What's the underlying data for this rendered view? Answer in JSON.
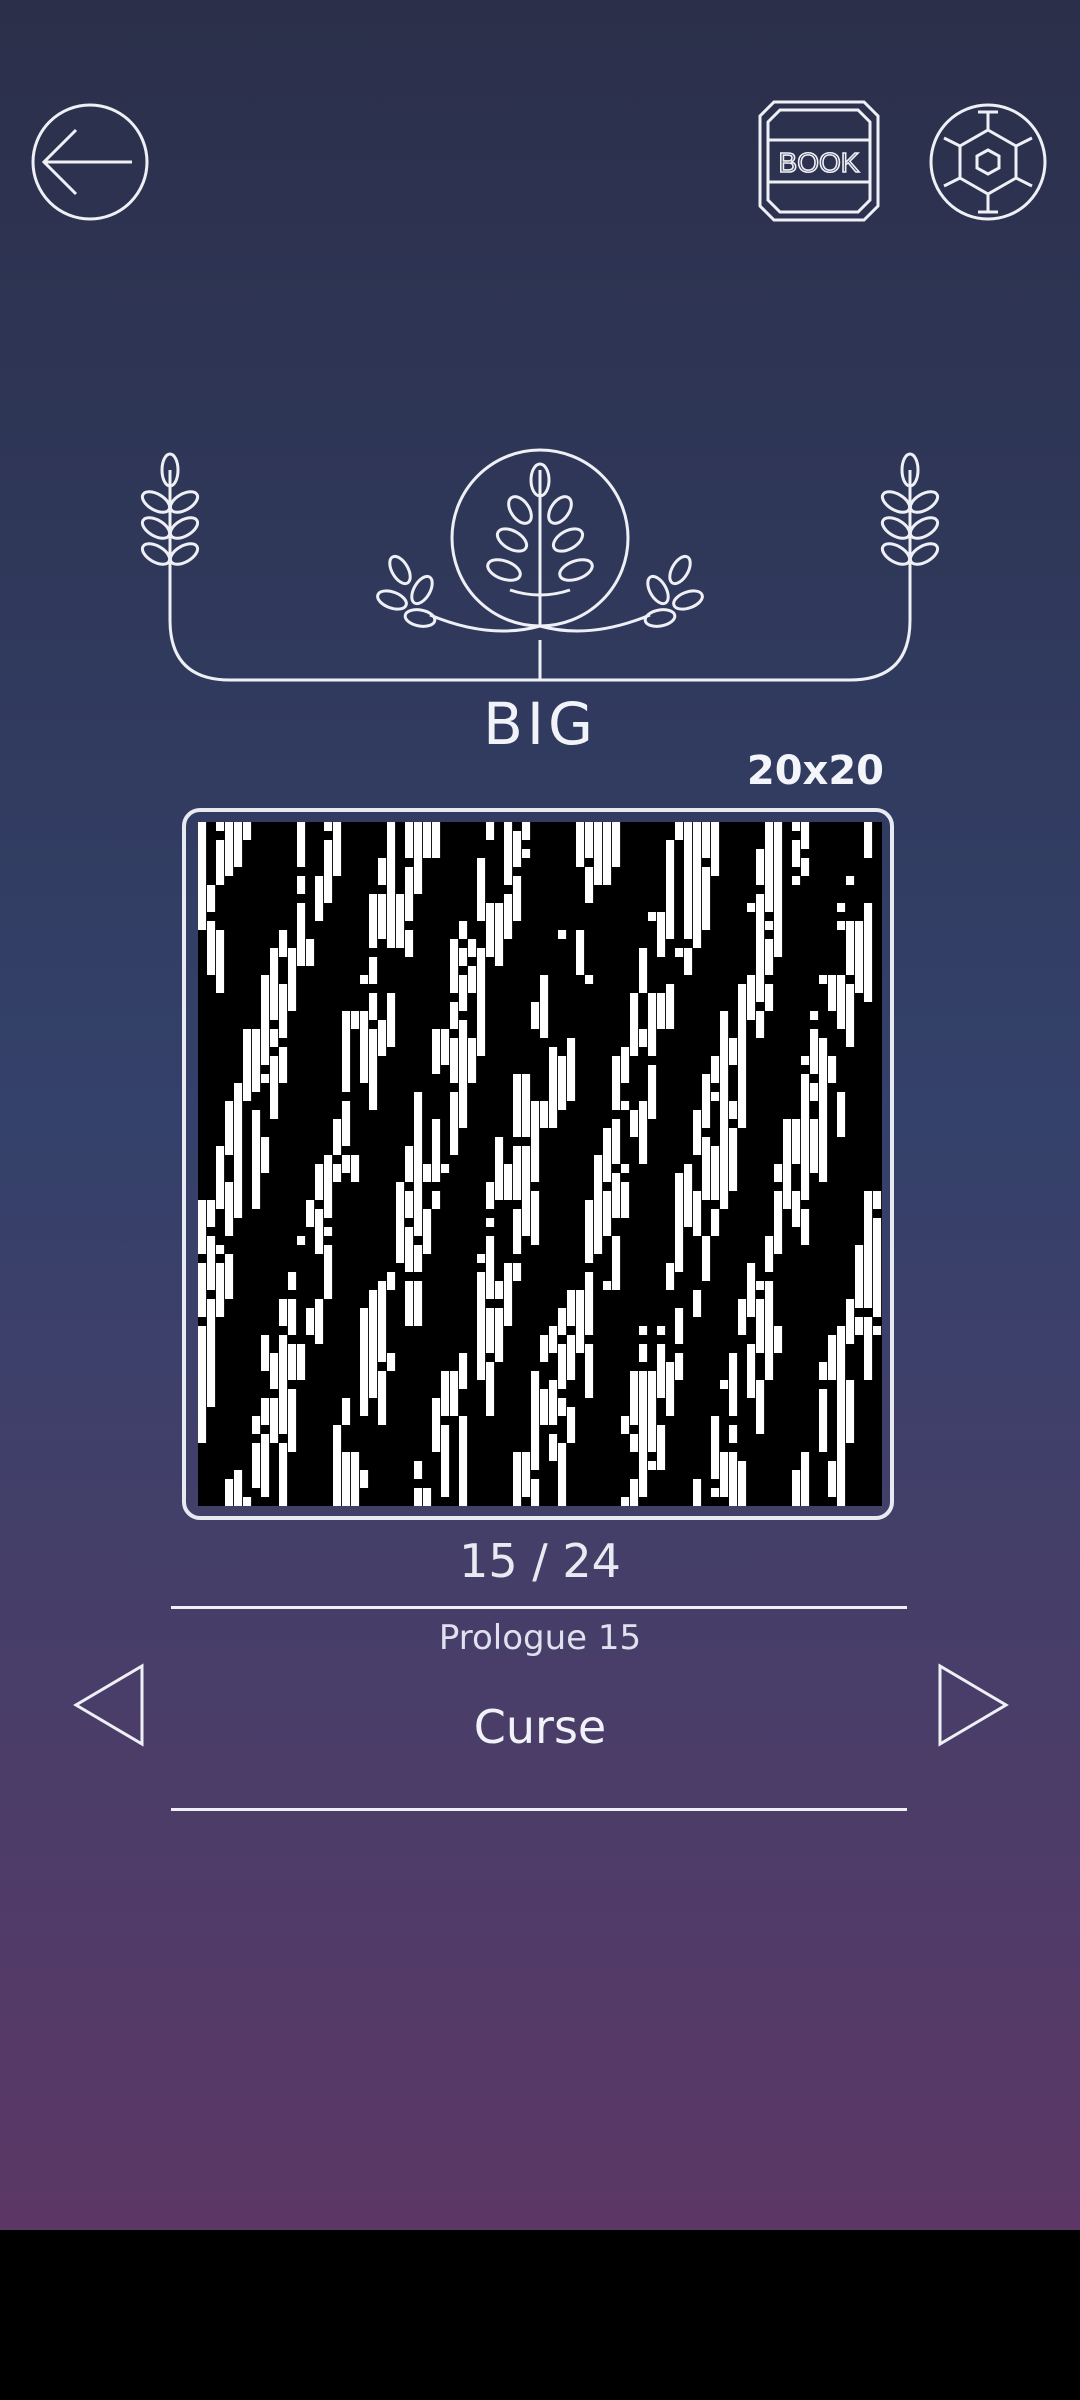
{
  "header": {
    "book_label": "BOOK"
  },
  "category": {
    "title": "BIG",
    "grid_size": "20x20"
  },
  "puzzle": {
    "counter": "15 / 24",
    "chapter": "Prologue 15",
    "name": "Curse"
  },
  "icons": {
    "back": "arrow-left-icon",
    "book": "book-icon",
    "settings": "gear-icon",
    "prev": "triangle-left-icon",
    "next": "triangle-right-icon"
  },
  "colors": {
    "background_top": "#2b2f4a",
    "background_mid": "#34416a",
    "background_bottom": "#5c3766",
    "line": "#eef0f6"
  }
}
